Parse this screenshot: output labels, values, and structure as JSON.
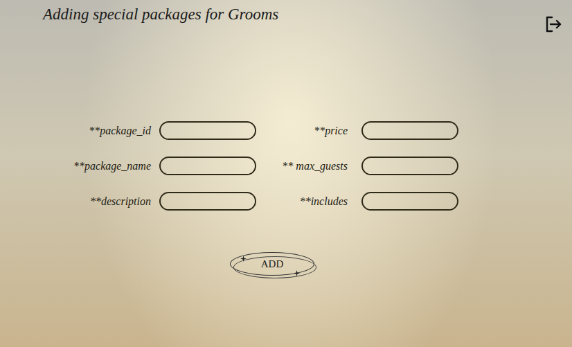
{
  "title": "Adding special packages for Grooms",
  "columns": [
    {
      "fields": [
        {
          "label": "**package_id"
        },
        {
          "label": "**package_name"
        },
        {
          "label": "**description"
        }
      ]
    },
    {
      "fields": [
        {
          "label": "**price"
        },
        {
          "label": "** max_guests"
        },
        {
          "label": "**includes"
        }
      ]
    }
  ],
  "button": "ADD"
}
